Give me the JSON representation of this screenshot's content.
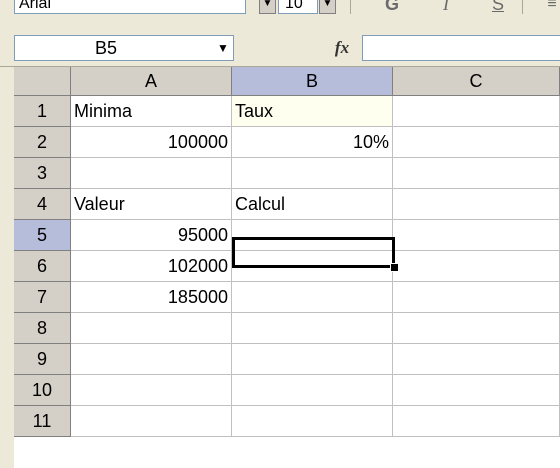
{
  "toolbar": {
    "font_name": "Arial",
    "font_size": "10",
    "bold_label": "G",
    "italic_label": "I",
    "underline_label": "S",
    "align_label": "≡"
  },
  "formula_bar": {
    "name_box": "B5",
    "fx_label": "fx",
    "formula": ""
  },
  "grid": {
    "columns": [
      "A",
      "B",
      "C"
    ],
    "active_column": "B",
    "rows": [
      "1",
      "2",
      "3",
      "4",
      "5",
      "6",
      "7",
      "8",
      "9",
      "10",
      "11"
    ],
    "active_row": "5",
    "active_cell": "B5",
    "cells": {
      "A1": "Minima",
      "B1": "Taux",
      "A2": "100000",
      "B2": "10%",
      "A4": "Valeur",
      "B4": "Calcul",
      "A5": "95000",
      "B5": "",
      "A6": "102000",
      "A7": "185000"
    }
  }
}
